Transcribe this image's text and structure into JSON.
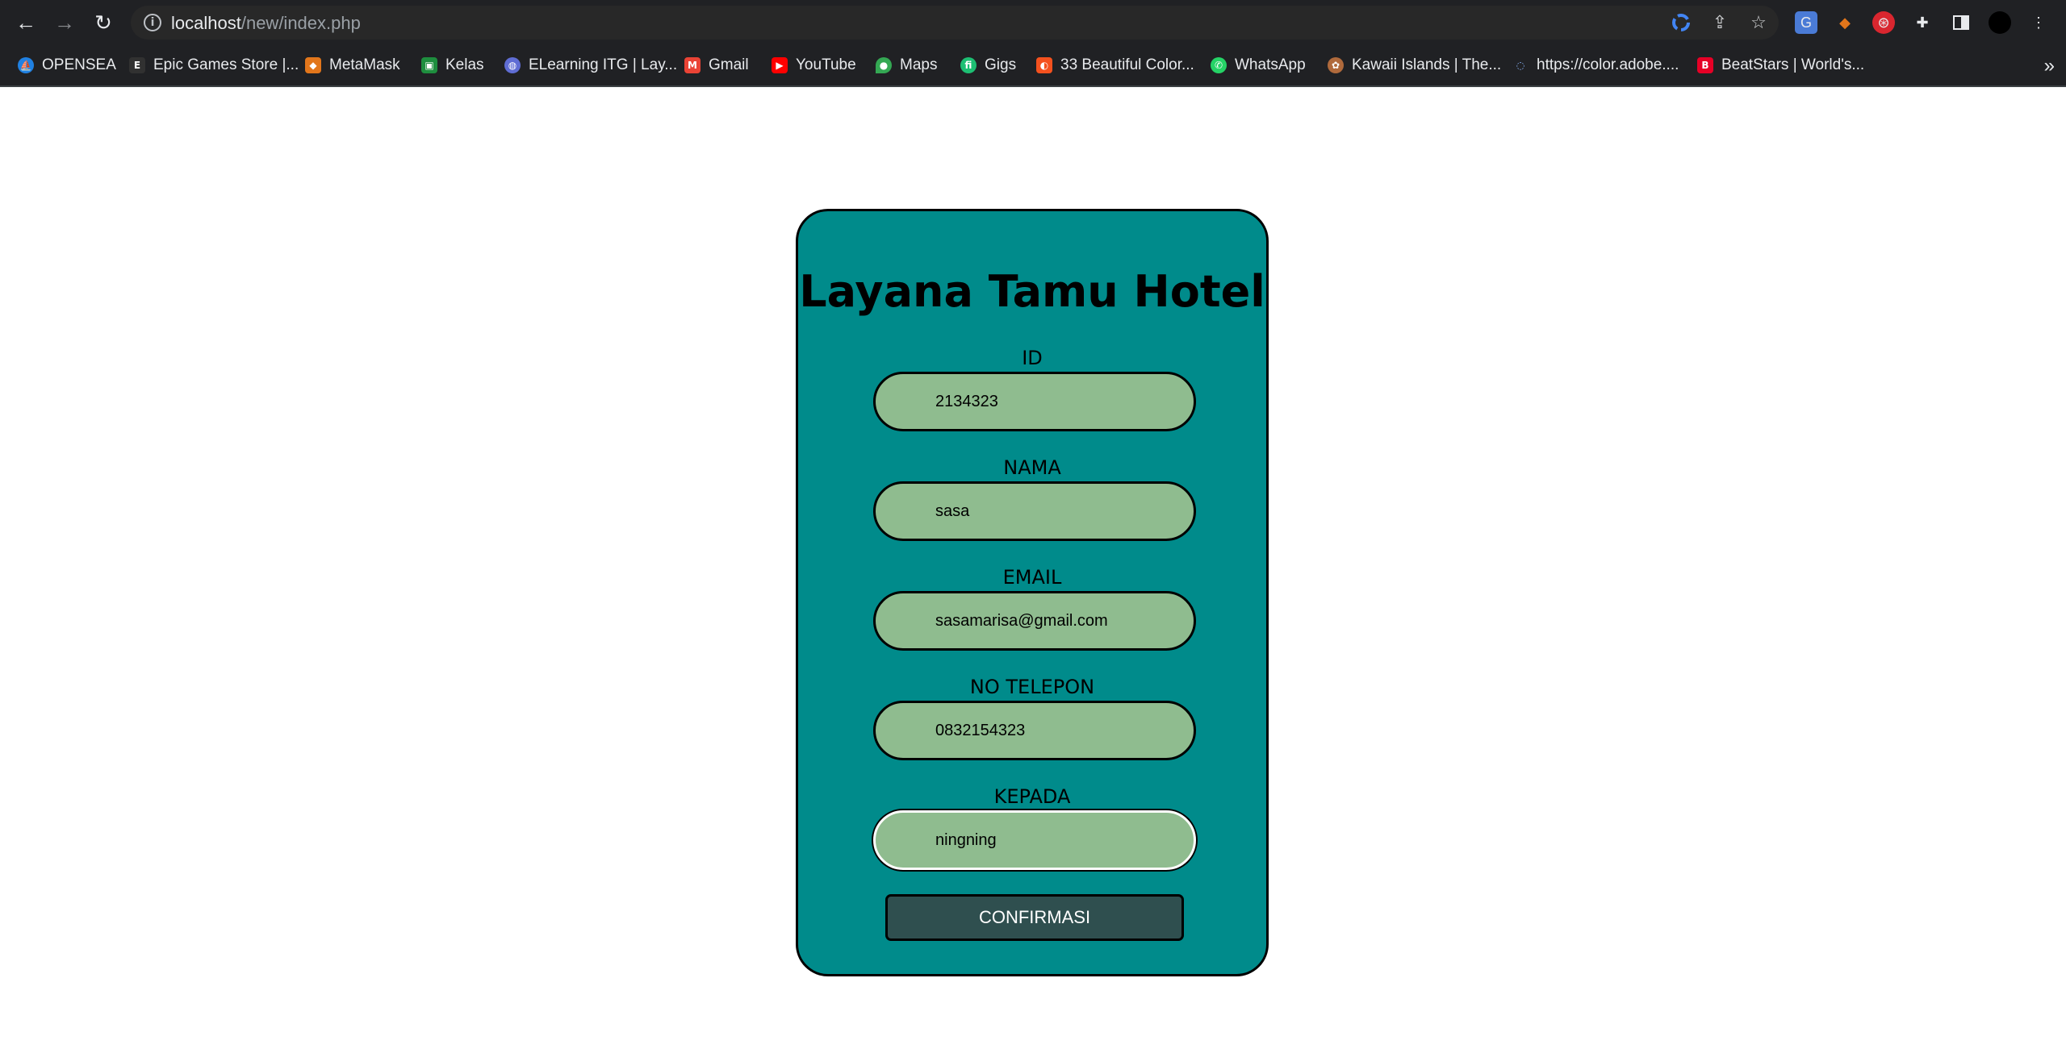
{
  "browser": {
    "url_host": "localhost",
    "url_path": "/new/index.php",
    "bookmarks": [
      {
        "label": "OPENSEA",
        "color": "#2081e2",
        "glyph": "⛵"
      },
      {
        "label": "Epic Games Store |...",
        "color": "#313131",
        "glyph": "E"
      },
      {
        "label": "MetaMask",
        "color": "#e2761b",
        "glyph": "🦊"
      },
      {
        "label": "Kelas",
        "color": "#1e8e3e",
        "glyph": "▣"
      },
      {
        "label": "ELearning ITG | Lay...",
        "color": "#5f6dd4",
        "glyph": "◍"
      },
      {
        "label": "Gmail",
        "color": "#ea4335",
        "glyph": "M"
      },
      {
        "label": "YouTube",
        "color": "#ff0000",
        "glyph": "▶"
      },
      {
        "label": "Maps",
        "color": "#34a853",
        "glyph": "⬤"
      },
      {
        "label": "Gigs",
        "color": "#1dbf73",
        "glyph": "fi"
      },
      {
        "label": "33 Beautiful Color...",
        "color": "#f4511e",
        "glyph": "◐"
      },
      {
        "label": "WhatsApp",
        "color": "#25d366",
        "glyph": "✆"
      },
      {
        "label": "Kawaii Islands | The...",
        "color": "#b06a3c",
        "glyph": "✿"
      },
      {
        "label": "https://color.adobe....",
        "color": "#202124",
        "glyph": "◌"
      },
      {
        "label": "BeatStars | World's...",
        "color": "#e60026",
        "glyph": "B"
      }
    ],
    "more_label": "»"
  },
  "form": {
    "title": "Layana Tamu Hotel",
    "fields": [
      {
        "label": "ID",
        "value": "2134323"
      },
      {
        "label": "NAMA",
        "value": "sasa"
      },
      {
        "label": "EMAIL",
        "value": "sasamarisa@gmail.com"
      },
      {
        "label": "NO TELEPON",
        "value": "0832154323"
      },
      {
        "label": "KEPADA",
        "value": "ningning"
      }
    ],
    "submit_label": "CONFIRMASI"
  },
  "colors": {
    "card": "#008b8b",
    "input": "#8fbc8f",
    "button": "#2f4f4f"
  }
}
